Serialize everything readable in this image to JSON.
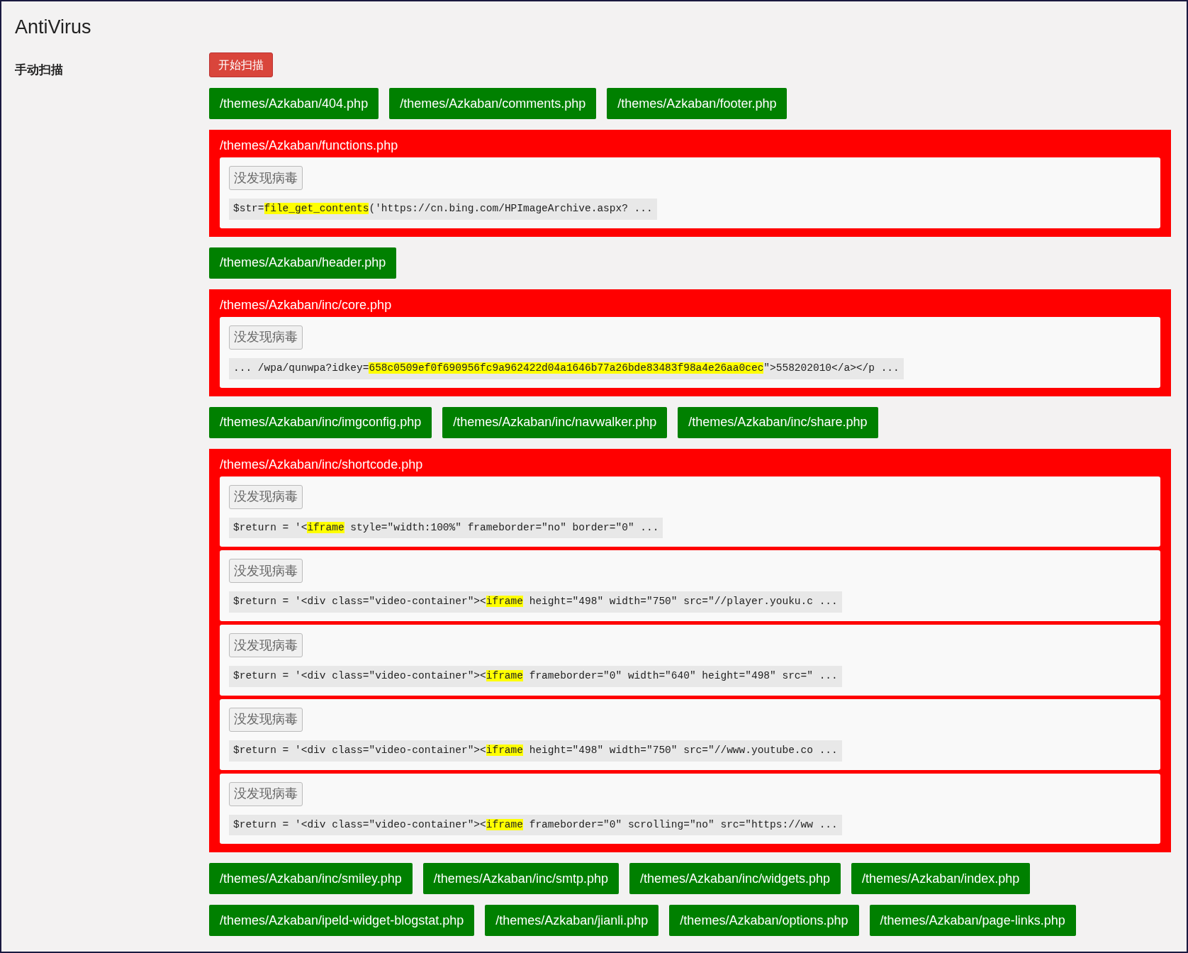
{
  "page": {
    "title": "AntiVirus"
  },
  "section": {
    "label": "手动扫描",
    "scan_button": "开始扫描"
  },
  "results": [
    {
      "kind": "clean",
      "files": [
        "/themes/Azkaban/404.php",
        "/themes/Azkaban/comments.php",
        "/themes/Azkaban/footer.php"
      ]
    },
    {
      "kind": "infected",
      "file": "/themes/Azkaban/functions.php",
      "findings": [
        {
          "button": "没发现病毒",
          "prefix": "$str=",
          "match": "file_get_contents",
          "suffix": "('https://cn.bing.com/HPImageArchive.aspx? ..."
        }
      ]
    },
    {
      "kind": "clean",
      "files": [
        "/themes/Azkaban/header.php"
      ]
    },
    {
      "kind": "infected",
      "file": "/themes/Azkaban/inc/core.php",
      "findings": [
        {
          "button": "没发现病毒",
          "prefix": "... /wpa/qunwpa?idkey=",
          "match": "658c0509ef0f690956fc9a962422d04a1646b77a26bde83483f98a4e26aa0cec",
          "suffix": "\">558202010</a></p ..."
        }
      ]
    },
    {
      "kind": "clean",
      "files": [
        "/themes/Azkaban/inc/imgconfig.php",
        "/themes/Azkaban/inc/navwalker.php",
        "/themes/Azkaban/inc/share.php"
      ]
    },
    {
      "kind": "infected",
      "file": "/themes/Azkaban/inc/shortcode.php",
      "findings": [
        {
          "button": "没发现病毒",
          "prefix": "$return = '<",
          "match": "iframe",
          "suffix": " style=\"width:100%\" frameborder=\"no\" border=\"0\" ..."
        },
        {
          "button": "没发现病毒",
          "prefix": "$return = '<div class=\"video-container\"><",
          "match": "iframe",
          "suffix": " height=\"498\" width=\"750\" src=\"//player.youku.c ..."
        },
        {
          "button": "没发现病毒",
          "prefix": "$return = '<div class=\"video-container\"><",
          "match": "iframe",
          "suffix": " frameborder=\"0\" width=\"640\" height=\"498\" src=\" ..."
        },
        {
          "button": "没发现病毒",
          "prefix": "$return = '<div class=\"video-container\"><",
          "match": "iframe",
          "suffix": " height=\"498\" width=\"750\" src=\"//www.youtube.co ..."
        },
        {
          "button": "没发现病毒",
          "prefix": "$return = '<div class=\"video-container\"><",
          "match": "iframe",
          "suffix": " frameborder=\"0\" scrolling=\"no\" src=\"https://ww ..."
        }
      ]
    },
    {
      "kind": "clean",
      "files": [
        "/themes/Azkaban/inc/smiley.php",
        "/themes/Azkaban/inc/smtp.php",
        "/themes/Azkaban/inc/widgets.php",
        "/themes/Azkaban/index.php",
        "/themes/Azkaban/ipeld-widget-blogstat.php",
        "/themes/Azkaban/jianli.php",
        "/themes/Azkaban/options.php",
        "/themes/Azkaban/page-links.php"
      ]
    }
  ]
}
